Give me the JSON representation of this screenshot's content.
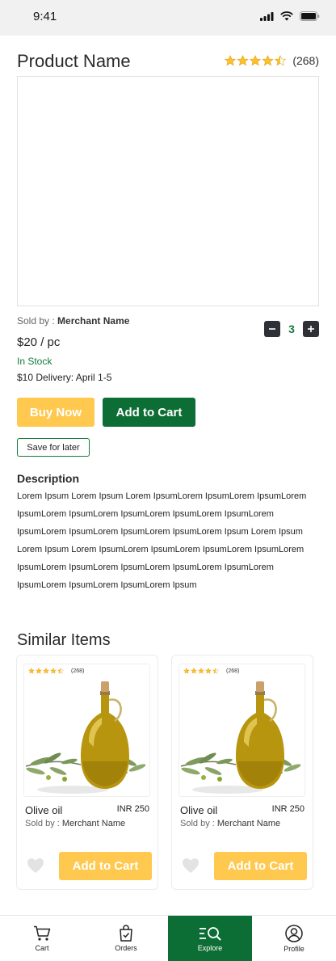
{
  "status_bar": {
    "time": "9:41"
  },
  "product": {
    "name": "Product Name",
    "rating_count": "(268)",
    "sold_by_label": "Sold by :",
    "merchant": "Merchant Name",
    "price": "$20 / pc",
    "stock": "In Stock",
    "delivery": "$10 Delivery: April 1-5",
    "quantity": "3",
    "rating": 4.5
  },
  "actions": {
    "buy_now": "Buy Now",
    "add_to_cart": "Add to Cart",
    "save_for_later": "Save for later"
  },
  "description": {
    "title": "Description",
    "text": "Lorem Ipsum Lorem Ipsum Lorem IpsumLorem IpsumLorem IpsumLorem IpsumLorem IpsumLorem IpsumLorem IpsumLorem IpsumLorem IpsumLorem IpsumLorem IpsumLorem IpsumLorem Ipsum Lorem Ipsum Lorem Ipsum Lorem IpsumLorem IpsumLorem IpsumLorem IpsumLorem IpsumLorem IpsumLorem IpsumLorem IpsumLorem IpsumLorem IpsumLorem IpsumLorem IpsumLorem Ipsum"
  },
  "similar": {
    "title": "Similar Items",
    "items": [
      {
        "rating_count": "(268)",
        "name": "Olive oil",
        "price": "INR 250",
        "sold_by_label": "Sold by :",
        "merchant": "Merchant Name",
        "add_label": "Add to Cart"
      },
      {
        "rating_count": "(268)",
        "name": "Olive oil",
        "price": "INR 250",
        "sold_by_label": "Sold by :",
        "merchant": "Merchant Name",
        "add_label": "Add to Cart"
      }
    ]
  },
  "nav": [
    {
      "label": "Cart",
      "icon": "cart-icon"
    },
    {
      "label": "Orders",
      "icon": "bag-icon"
    },
    {
      "label": "Explore",
      "icon": "explore-icon"
    },
    {
      "label": "Profile",
      "icon": "profile-icon"
    }
  ],
  "colors": {
    "primary_green": "#0d6e35",
    "accent_yellow": "#ffc84e",
    "star": "#fcc02c"
  }
}
